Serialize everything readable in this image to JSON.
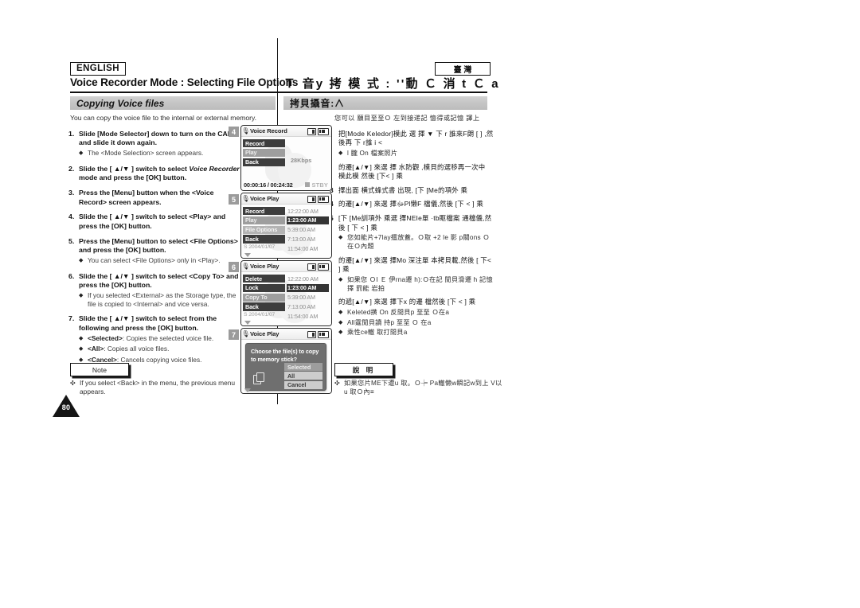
{
  "header": {
    "english_badge": "ENGLISH",
    "taiwan_badge": "臺 灣",
    "title_en": "Voice Recorder Mode : Selecting File Options",
    "title_cn": "Ｔ 音y 拷 模 式 : ''動 Ｃ 消  t Ｃ a"
  },
  "section": {
    "title_en": "Copying Voice files",
    "title_cn": "拷貝攝音:∧",
    "intro_en": "You can copy the voice file to the internal or external memory.",
    "intro_cn": "您可以 願目至至Ｏ 左到接递記 憶得或記憶 譯上"
  },
  "steps_en": [
    {
      "num": "1.",
      "text": "Slide [Mode Selector] down to turn on the CAM and slide it down again.",
      "subs": [
        {
          "text": "The <Mode Selection> screen appears."
        }
      ]
    },
    {
      "num": "2.",
      "text_pre": "Slide the [ ▲/▼ ] switch to select ",
      "text_italic": "Voice Recorder",
      "text_post": " mode and press the [OK] button.",
      "subs": []
    },
    {
      "num": "3.",
      "text": "Press the [Menu] button when the <Voice Record> screen appears.",
      "subs": []
    },
    {
      "num": "4.",
      "text": "Slide the [ ▲/▼ ] switch to select <Play> and press the [OK] button.",
      "subs": []
    },
    {
      "num": "5.",
      "text": "Press the [Menu] button to select <File Options> and press the [OK] button.",
      "subs": [
        {
          "text": "You can select <File Options> only in <Play>."
        }
      ]
    },
    {
      "num": "6.",
      "text": "Slide the [ ▲/▼ ] switch to select <Copy To> and press the [OK] button.",
      "subs": [
        {
          "text": "If you selected <External> as the Storage type, the file is copied to <Internal> and vice versa."
        }
      ]
    },
    {
      "num": "7.",
      "text": "Slide the [ ▲/▼ ] switch to select from the following and press the [OK] button.",
      "subs": [
        {
          "bold": "<Selected>",
          "text": ": Copies the selected voice file."
        },
        {
          "bold": "<All>",
          "text": ": Copies all voice files."
        },
        {
          "bold": "<Cancel>",
          "text": ": Cancels copying voice files."
        }
      ]
    }
  ],
  "steps_cn": [
    {
      "num": "",
      "text": "把[Mode Keledor]模此 選 揮 ▼ 下 r 誰來F朗 [ ] ,然後再 下 r誰 i <",
      "subs": [
        {
          "text": "l 朧 On 檔案照片"
        }
      ]
    },
    {
      "num": "",
      "text": "的遷[▲/▼] 來選 擇 水防觀 ,模貝的選移再一次中 模此模 然後 [下< ] 乘",
      "subs": []
    },
    {
      "num": "3",
      "text": "擇出面 横式蜂式書 出現, [下 [Me的項外 乘",
      "subs": []
    },
    {
      "num": "4",
      "text": "的遷[▲/▼] 來選 擇ﷻPl懒F 檔儀,然後 [下 < ] 乘",
      "subs": []
    },
    {
      "num": "5",
      "text": "[下 [Me訓項外 乘選 擇NEIe單 ·tb眍檔案 通檔儀,然後 [ 下 < ] 乘",
      "subs": [
        {
          "text": "您如能片+7lay擂放蓋。Ｏ取 +2 le 影 p關ons Ｏ 在Ｏ內題"
        }
      ]
    },
    {
      "num": "",
      "text": "的遷[▲/▼] 來選 擇Мo 深注單 本拷貝載,然後 [ 下< ] 乘",
      "subs": [
        {
          "text": "如果您 ＯI Ｅ 伊rna遷 h):Ｏ在記 閒貝滑遷 h 記憶擇 罰能 岩拍"
        }
      ]
    },
    {
      "num": "",
      "text": "的遞[▲/▼] 來選 擇下x 的遷 檔然後 [下 < ] 乘",
      "subs": [
        {
          "text": "Keleted撗 On 反閒貝p 至至 Ｏ在a"
        },
        {
          "text": "All霆閒貝讀 持p 至至 Ｏ 在a"
        },
        {
          "text": "乘性ce轍 取打閒貝a"
        }
      ]
    }
  ],
  "notes": {
    "label_en": "Note",
    "label_cn": "說 明",
    "text_en": "If you select <Back> in the menu, the previous menu appears.",
    "text_cn": "如果您片ME下遭u 取。Ｏ┾ Pa轍懒w瞬記w到上 V以u 取Ｏ內≡"
  },
  "page_number": "80",
  "screens": [
    {
      "step": "4",
      "title": "Voice Record",
      "type": "record",
      "menu": [
        {
          "label": "Record",
          "style": "dark"
        },
        {
          "label": "Play",
          "style": "grey"
        },
        {
          "label": "Back",
          "style": "dark"
        }
      ],
      "bitrate": "28Kbps",
      "timecode": "00:00:16 / 00:24:32",
      "status": "STBY"
    },
    {
      "step": "5",
      "title": "Voice Play",
      "type": "list",
      "menu": [
        {
          "label": "Record",
          "style": "dark"
        },
        {
          "label": "Play",
          "style": "grey"
        },
        {
          "label": "File Options",
          "style": "lgrey"
        },
        {
          "label": "Back",
          "style": "dark"
        }
      ],
      "times": [
        {
          "label": "12:22:00 AM",
          "selected": false
        },
        {
          "label": "1:23:00 AM",
          "selected": true
        },
        {
          "label": "5:39:00 AM",
          "selected": false
        },
        {
          "label": "7:13:00 AM",
          "selected": false
        },
        {
          "label": "11:54:00 AM",
          "selected": false
        }
      ],
      "date": "S  2004/01/07"
    },
    {
      "step": "6",
      "title": "Voice Play",
      "type": "list",
      "menu": [
        {
          "label": "Delete",
          "style": "dark"
        },
        {
          "label": "Lock",
          "style": "dark"
        },
        {
          "label": "Copy To",
          "style": "grey"
        },
        {
          "label": "Back",
          "style": "dark"
        }
      ],
      "times": [
        {
          "label": "12:22:00 AM",
          "selected": false
        },
        {
          "label": "1:23:00 AM",
          "selected": true
        },
        {
          "label": "5:39:00 AM",
          "selected": false
        },
        {
          "label": "7:13:00 AM",
          "selected": false
        },
        {
          "label": "11:54:00 AM",
          "selected": false
        }
      ],
      "date": "S  2004/01/07"
    },
    {
      "step": "7",
      "title": "Voice Play",
      "type": "dialog",
      "dialog_message": "Choose the file(s) to copy to memory stick?",
      "options": [
        {
          "label": "Selected",
          "selected": true
        },
        {
          "label": "All",
          "selected": false
        },
        {
          "label": "Cancel",
          "selected": false
        }
      ]
    }
  ]
}
